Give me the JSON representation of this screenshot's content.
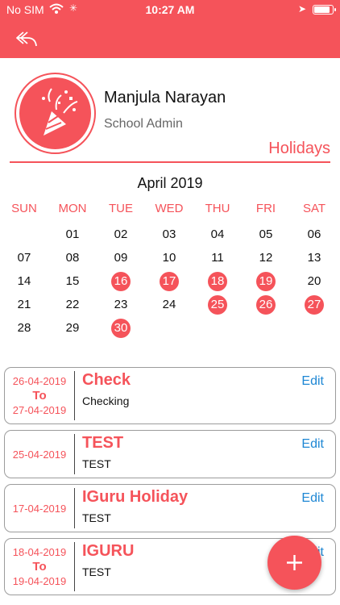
{
  "status_bar": {
    "carrier": "No SIM",
    "time": "10:27 AM",
    "battery_level": 0.9
  },
  "profile": {
    "name": "Manjula Narayan",
    "role": "School Admin"
  },
  "section_title": "Holidays",
  "calendar": {
    "month_label": "April 2019",
    "weekdays": [
      "SUN",
      "MON",
      "TUE",
      "WED",
      "THU",
      "FRI",
      "SAT"
    ],
    "days": [
      "01",
      "02",
      "03",
      "04",
      "05",
      "06",
      "07",
      "08",
      "09",
      "10",
      "11",
      "12",
      "13",
      "14",
      "15",
      "16",
      "17",
      "18",
      "19",
      "20",
      "21",
      "22",
      "23",
      "24",
      "25",
      "26",
      "27",
      "28",
      "29",
      "30"
    ],
    "first_weekday_index": 1,
    "holidays": [
      "16",
      "17",
      "18",
      "19",
      "25",
      "26",
      "27",
      "30"
    ]
  },
  "holidays": [
    {
      "from": "26-04-2019",
      "to_label": "To",
      "to": "27-04-2019",
      "title": "Check",
      "description": "Checking",
      "edit_label": "Edit"
    },
    {
      "from": "25-04-2019",
      "title": "TEST",
      "description": "TEST",
      "edit_label": "Edit"
    },
    {
      "from": "17-04-2019",
      "title": "IGuru Holiday",
      "description": "TEST",
      "edit_label": "Edit"
    },
    {
      "from": "18-04-2019",
      "to_label": "To",
      "to": "19-04-2019",
      "title": "IGURU",
      "description": "TEST",
      "edit_label": "Edit"
    }
  ],
  "colors": {
    "accent": "#f5535a",
    "link": "#1e87d4"
  }
}
